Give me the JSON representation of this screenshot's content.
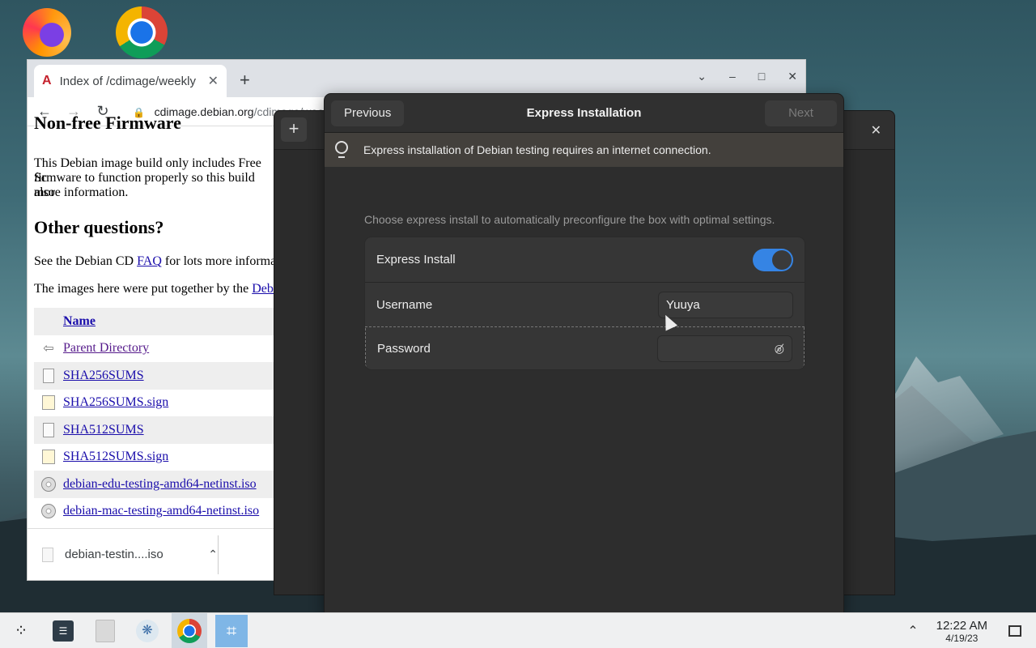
{
  "browser": {
    "tab_title": "Index of /cdimage/weekly",
    "tab_icon": "A",
    "url_host": "cdimage.debian.org",
    "url_path": "/cdimage/weekly",
    "heading_nonfree": "Non-free Firmware",
    "nonfree_lines": [
      "This Debian image build only includes Free Sc",
      "firmware to function properly so this build also",
      "more information."
    ],
    "heading_other": "Other questions?",
    "faq_prefix": "See the Debian CD ",
    "faq_link": "FAQ",
    "faq_suffix": " for lots more informa",
    "images_prefix": "The images here were put together by the ",
    "images_link": "Debi",
    "table_header": "Name",
    "files": [
      {
        "name": "Parent Directory",
        "icon": "back-icon"
      },
      {
        "name": "SHA256SUMS",
        "icon": "document-icon"
      },
      {
        "name": "SHA256SUMS.sign",
        "icon": "signature-icon"
      },
      {
        "name": "SHA512SUMS",
        "icon": "document-icon"
      },
      {
        "name": "SHA512SUMS.sign",
        "icon": "signature-icon"
      },
      {
        "name": "debian-edu-testing-amd64-netinst.iso",
        "icon": "disc-icon"
      },
      {
        "name": "debian-mac-testing-amd64-netinst.iso",
        "icon": "disc-icon"
      }
    ],
    "download_name": "debian-testin....iso"
  },
  "dialog": {
    "title": "Express Installation",
    "previous_label": "Previous",
    "next_label": "Next",
    "banner_text": "Express installation of Debian testing requires an internet connection.",
    "description": "Choose express install to automatically preconfigure the box with optimal settings.",
    "express_label": "Express Install",
    "express_on": true,
    "username_label": "Username",
    "username_value": "Yuuya",
    "password_label": "Password",
    "password_value": ""
  },
  "taskbar": {
    "time": "12:22 AM",
    "date": "4/19/23"
  },
  "colors": {
    "accent": "#3584e4",
    "dialog_bg": "#2d2d2d",
    "banner_bg": "#43403c",
    "taskbar_bg": "#eff0f1"
  }
}
